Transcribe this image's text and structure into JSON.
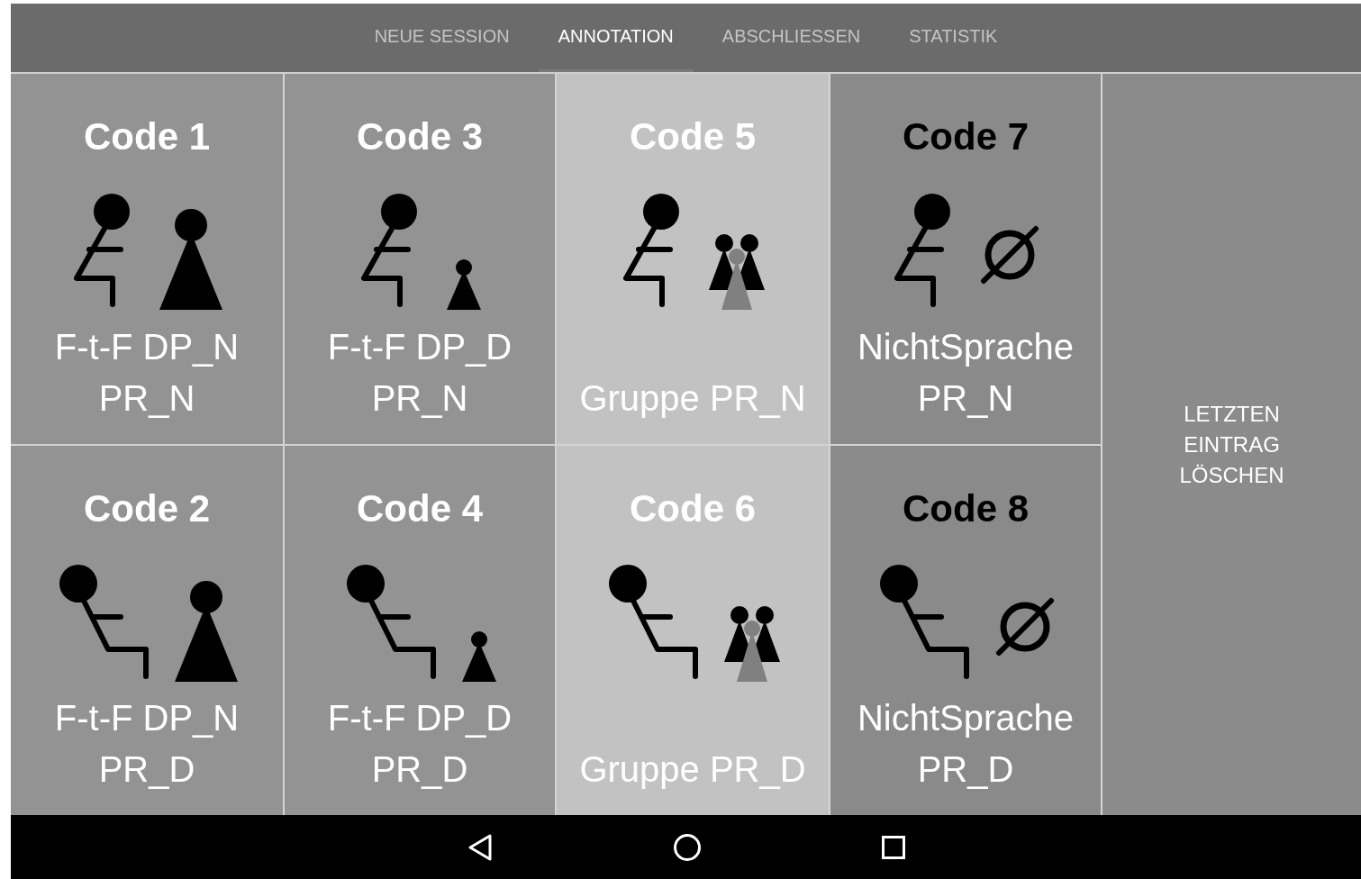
{
  "tabs": [
    {
      "label": "NEUE SESSION",
      "selected": false
    },
    {
      "label": "ANNOTATION",
      "selected": true
    },
    {
      "label": "ABSCHLIESSEN",
      "selected": false
    },
    {
      "label": "STATISTIK",
      "selected": false
    }
  ],
  "codes": [
    {
      "title": "Code 1",
      "label": "F-t-F DP_N PR_N",
      "reclined": false,
      "kind": "large",
      "color": "#939393",
      "dark_title": false
    },
    {
      "title": "Code 3",
      "label": "F-t-F DP_D PR_N",
      "reclined": false,
      "kind": "small",
      "color": "#939393",
      "dark_title": false
    },
    {
      "title": "Code 5",
      "label": "Gruppe PR_N",
      "reclined": false,
      "kind": "group",
      "color": "#c2c2c2",
      "dark_title": false
    },
    {
      "title": "Code 7",
      "label": "NichtSprache PR_N",
      "reclined": false,
      "kind": "none",
      "color": "#8a8a8a",
      "dark_title": true
    },
    {
      "title": "Code 2",
      "label": "F-t-F DP_N PR_D",
      "reclined": true,
      "kind": "large",
      "color": "#939393",
      "dark_title": false
    },
    {
      "title": "Code 4",
      "label": "F-t-F DP_D PR_D",
      "reclined": true,
      "kind": "small",
      "color": "#939393",
      "dark_title": false
    },
    {
      "title": "Code 6",
      "label": "Gruppe PR_D",
      "reclined": true,
      "kind": "group",
      "color": "#c2c2c2",
      "dark_title": false
    },
    {
      "title": "Code 8",
      "label": "NichtSprache PR_D",
      "reclined": true,
      "kind": "none",
      "color": "#8a8a8a",
      "dark_title": true
    }
  ],
  "delete_button": "LETZTEN EINTRAG LÖSCHEN"
}
